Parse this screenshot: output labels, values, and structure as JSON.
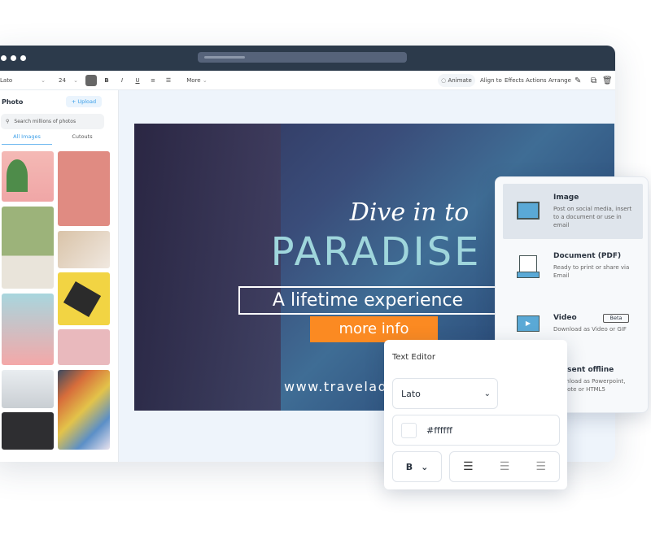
{
  "toolbar": {
    "font": "Lato",
    "size": "24",
    "bold": "B",
    "italic": "I",
    "underline": "U",
    "more": "More",
    "animate": "Animate",
    "align_to": "Align to",
    "effects": "Effects",
    "actions": "Actions",
    "arrange": "Arrange"
  },
  "left_panel": {
    "title": "Photo",
    "upload": "+ Upload",
    "search_placeholder": "Search millions of photos",
    "tabs": [
      "All Images",
      "Cutouts"
    ],
    "active_tab": "All Images"
  },
  "design": {
    "script_title": "Dive in to",
    "big_title": "PARADISE",
    "subtitle": "A lifetime experience",
    "cta": "more info",
    "url": "www.traveladv",
    "accent": "#fb8a22"
  },
  "export_panel": {
    "items": [
      {
        "title": "Image",
        "desc": "Post on social media, insert to a document or use in email",
        "icon": "image-icon",
        "selected": true
      },
      {
        "title": "Document (PDF)",
        "desc": "Ready to print or share via Email",
        "icon": "printer-icon"
      },
      {
        "title": "Video",
        "desc": "Download as Video or GIF",
        "icon": "video-icon",
        "badge": "Beta"
      },
      {
        "title": "Present offline",
        "desc": "Download as Powerpoint, Keynote or HTML5",
        "icon": "projector-icon"
      }
    ]
  },
  "text_editor": {
    "title": "Text Editor",
    "font": "Lato",
    "color": "#ffffff",
    "weight": "B"
  }
}
